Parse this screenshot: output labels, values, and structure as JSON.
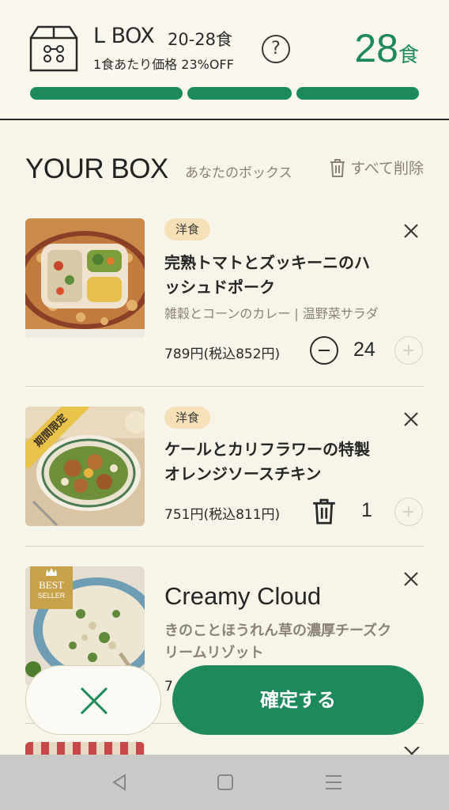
{
  "header": {
    "plan_name": "L BOX",
    "plan_range": "20-28食",
    "discount": "1食あたり価格 23%OFF",
    "help": "?",
    "meal_count": "28",
    "meal_unit": "食",
    "progress": 1.0
  },
  "section": {
    "title": "YOUR BOX",
    "subtitle": "あなたのボックス",
    "delete_all": "すべて削除"
  },
  "items": [
    {
      "tag": "洋食",
      "name_line1": "完熟トマトとズッキーニのハ",
      "name_line2": "ッシュドポーク",
      "sides": "雑穀とコーンのカレー | 温野菜サラダ",
      "price": "789円(税込852円)",
      "qty": "24"
    },
    {
      "tag": "洋食",
      "badge": "期間限定",
      "name_line1": "ケールとカリフラワーの特製",
      "name_line2": "オレンジソースチキン",
      "price": "751円(税込811円)",
      "qty": "1"
    },
    {
      "badge_line1": "BEST",
      "badge_line2": "SELLER",
      "name": "Creamy Cloud",
      "sides_line1": "きのことほうれん草の濃厚チーズク",
      "sides_line2": "リームリゾット",
      "price_partial": "7"
    }
  ],
  "buttons": {
    "confirm": "確定する"
  },
  "colors": {
    "accent": "#1e8a5c",
    "background": "#f7f4e9",
    "tag": "#f5e0b8"
  }
}
